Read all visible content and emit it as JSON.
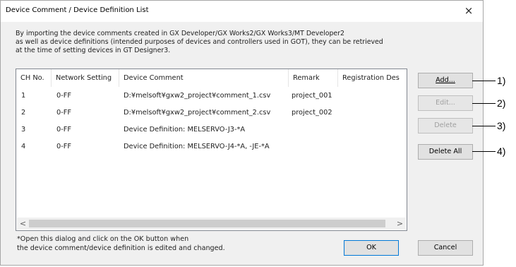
{
  "window": {
    "title": "Device Comment / Device Definition List",
    "close_glyph": "×"
  },
  "description": [
    "By importing the device comments created in GX Developer/GX Works2/GX Works3/MT Developer2",
    "as well as device definitions (intended purposes of devices and controllers used in GOT), they can be retrieved",
    "at the time of setting devices in GT Designer3."
  ],
  "table": {
    "columns": [
      "CH No.",
      "Network Setting",
      "Device Comment",
      "Remark",
      "Registration Des"
    ],
    "rows": [
      [
        "1",
        "0-FF",
        "D:¥melsoft¥gxw2_project¥comment_1.csv",
        "project_001",
        ""
      ],
      [
        "2",
        "0-FF",
        "D:¥melsoft¥gxw2_project¥comment_2.csv",
        "project_002",
        ""
      ],
      [
        "3",
        "0-FF",
        "Device Definition: MELSERVO-J3-*A",
        "",
        ""
      ],
      [
        "4",
        "0-FF",
        "Device Definition: MELSERVO-J4-*A, -JE-*A",
        "",
        ""
      ]
    ],
    "scroll_left": "<",
    "scroll_right": ">"
  },
  "buttons": {
    "add": "Add...",
    "edit": "Edit...",
    "delete": "Delete",
    "delete_all": "Delete All",
    "ok": "OK",
    "cancel": "Cancel"
  },
  "footnote": [
    "*Open this dialog and click on the OK button when",
    " the device comment/device definition is edited and changed."
  ],
  "callouts": [
    "1)",
    "2)",
    "3)",
    "4)"
  ]
}
